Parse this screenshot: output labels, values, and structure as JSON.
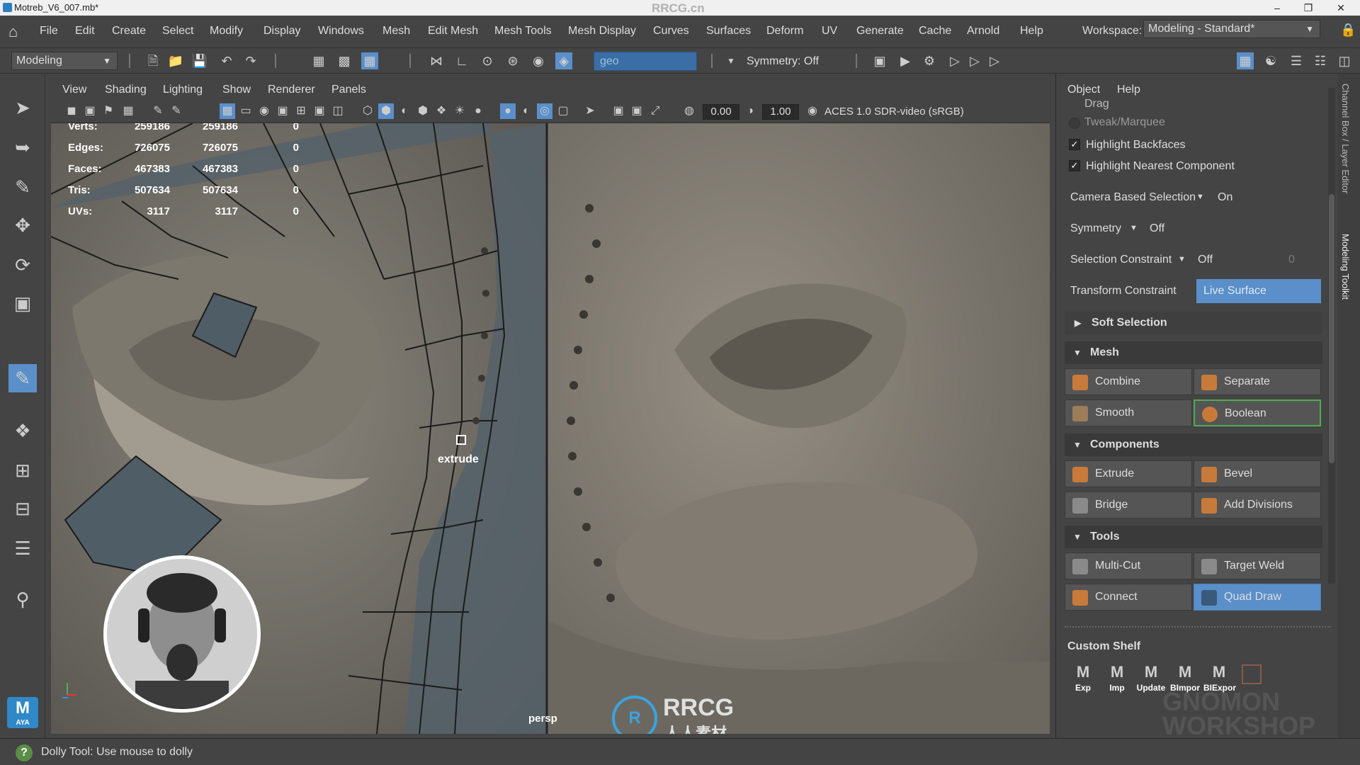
{
  "window": {
    "title": "Motreb_V6_007.mb*",
    "watermark_top": "RRCG.cn"
  },
  "menu": [
    "File",
    "Edit",
    "Create",
    "Select",
    "Modify",
    "Display",
    "Windows",
    "Mesh",
    "Edit Mesh",
    "Mesh Tools",
    "Mesh Display",
    "Curves",
    "Surfaces",
    "Deform",
    "UV",
    "Generate",
    "Cache",
    "Arnold",
    "Help"
  ],
  "workspace": {
    "label": "Workspace:",
    "value": "Modeling - Standard*"
  },
  "toolbar": {
    "mode": "Modeling",
    "search_value": "geo",
    "symmetry": "Symmetry: Off"
  },
  "viewport_menu": [
    "View",
    "Shading",
    "Lighting",
    "Show",
    "Renderer",
    "Panels"
  ],
  "viewport_toolbar": {
    "exposure": "0.00",
    "gamma": "1.00",
    "colorspace": "ACES 1.0 SDR-video (sRGB)"
  },
  "hud": {
    "rows": [
      {
        "label": "Verts:",
        "a": "259186",
        "b": "259186",
        "c": "0"
      },
      {
        "label": "Edges:",
        "a": "726075",
        "b": "726075",
        "c": "0"
      },
      {
        "label": "Faces:",
        "a": "467383",
        "b": "467383",
        "c": "0"
      },
      {
        "label": "Tris:",
        "a": "507634",
        "b": "507634",
        "c": "0"
      },
      {
        "label": "UVs:",
        "a": "3117",
        "b": "3117",
        "c": "0"
      }
    ],
    "camera": "persp",
    "hotbox_hint": "extrude"
  },
  "panel": {
    "tabs": [
      "Object",
      "Help"
    ],
    "drag": "Drag",
    "tweak": "Tweak/Marquee",
    "highlight_backfaces": "Highlight Backfaces",
    "highlight_nearest": "Highlight Nearest Component",
    "camera_sel_label": "Camera Based Selection",
    "camera_sel_value": "On",
    "symmetry_label": "Symmetry",
    "symmetry_value": "Off",
    "sel_constraint_label": "Selection Constraint",
    "sel_constraint_value": "Off",
    "sel_constraint_num": "0",
    "transform_label": "Transform Constraint",
    "transform_value": "Live Surface",
    "soft_selection": "Soft Selection",
    "mesh_section": "Mesh",
    "components_section": "Components",
    "tools_section": "Tools",
    "buttons": {
      "combine": "Combine",
      "separate": "Separate",
      "smooth": "Smooth",
      "boolean": "Boolean",
      "extrude": "Extrude",
      "bevel": "Bevel",
      "bridge": "Bridge",
      "add_divisions": "Add Divisions",
      "multicut": "Multi-Cut",
      "target_weld": "Target Weld",
      "connect": "Connect",
      "quad_draw": "Quad Draw"
    },
    "custom_shelf": "Custom Shelf",
    "shelf_items": [
      "Exp",
      "Imp",
      "Update",
      "BImpor",
      "BIExpor"
    ]
  },
  "side_tabs": [
    "Channel Box / Layer Editor",
    "Modeling Toolkit"
  ],
  "status": {
    "text": "Dolly Tool: Use mouse to dolly"
  },
  "watermark": {
    "brand": "RRCG",
    "sub": "人人素材",
    "gnomon": "GNOMON WORKSHOP",
    "maya_badge": "AYA"
  },
  "colors": {
    "accent": "#3a6ea5",
    "highlight": "#5a8fc9",
    "boolean_border": "#4caf50"
  }
}
